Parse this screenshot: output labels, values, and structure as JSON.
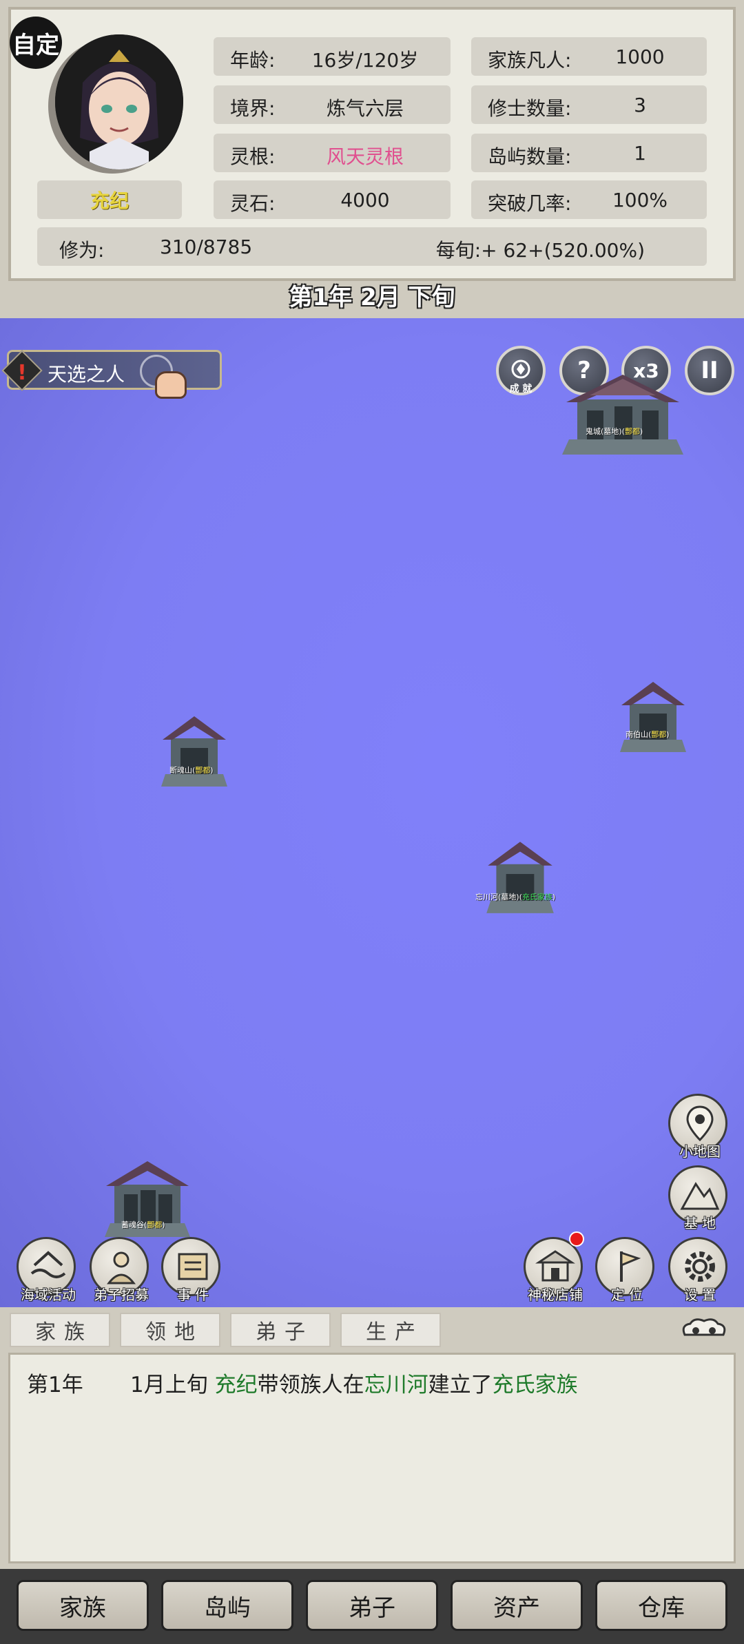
{
  "header": {
    "mode_badge": "自定",
    "character_name": "充纪",
    "stats_left": [
      {
        "label": "年龄:",
        "value": "16岁/120岁"
      },
      {
        "label": "境界:",
        "value": "炼气六层"
      },
      {
        "label": "灵根:",
        "value": "风天灵根"
      },
      {
        "label": "灵石:",
        "value": "4000"
      }
    ],
    "stats_right": [
      {
        "label": "家族凡人:",
        "value": "1000"
      },
      {
        "label": "修士数量:",
        "value": "3"
      },
      {
        "label": "岛屿数量:",
        "value": "1"
      },
      {
        "label": "突破几率:",
        "value": "100%"
      }
    ],
    "cultivation": {
      "label": "修为:",
      "value": "310/8785",
      "per_turn": "每旬:+ 62+(520.00%)"
    },
    "date": "第1年 2月 下旬"
  },
  "map": {
    "quest": {
      "label": "天选之人",
      "icon": "warning-icon"
    },
    "top_buttons": [
      {
        "icon": "achievement-icon",
        "caption": "成 就"
      },
      {
        "icon": "help-icon",
        "glyph": "?"
      },
      {
        "icon": "speed-icon",
        "glyph": "x3"
      },
      {
        "icon": "pause-icon",
        "glyph": "II"
      }
    ],
    "locations": [
      {
        "name": "鬼城(墓地)",
        "tag": "酆都"
      },
      {
        "name": "南伯山",
        "tag": "酆都"
      },
      {
        "name": "断魂山",
        "tag": "酆都"
      },
      {
        "name": "忘川河(墓地)",
        "tag": "充氏家族"
      },
      {
        "name": "蓄魂谷",
        "tag": "酆都"
      }
    ],
    "left_buttons": [
      {
        "icon": "sea-activity-icon",
        "caption": "海域活动"
      },
      {
        "icon": "disciple-recruit-icon",
        "caption": "弟子招募"
      },
      {
        "icon": "event-scroll-icon",
        "caption": "事 件"
      }
    ],
    "right_buttons": [
      {
        "icon": "minimap-icon",
        "caption": "小地图"
      },
      {
        "icon": "base-mountain-icon",
        "caption": "基 地"
      },
      {
        "icon": "mystery-shop-icon",
        "caption": "神秘店铺"
      },
      {
        "icon": "locate-flag-icon",
        "caption": "定 位"
      },
      {
        "icon": "settings-gear-icon",
        "caption": "设 置"
      }
    ]
  },
  "log": {
    "tabs": [
      "家族",
      "领地",
      "弟子",
      "生产"
    ],
    "entries": [
      {
        "year": "第1年",
        "time": "1月上旬",
        "actor": "充纪",
        "t1": "带领族人在",
        "place": "忘川河",
        "t2": "建立了",
        "clan": "充氏家族"
      }
    ]
  },
  "nav": {
    "items": [
      "家族",
      "岛屿",
      "弟子",
      "资产",
      "仓库"
    ]
  },
  "colors": {
    "map_water": "#7d7df3",
    "panel": "#ecebe2",
    "accent_pink": "#e0508f",
    "log_green": "#1e7a2a",
    "name_yellow": "#e7d43d"
  }
}
